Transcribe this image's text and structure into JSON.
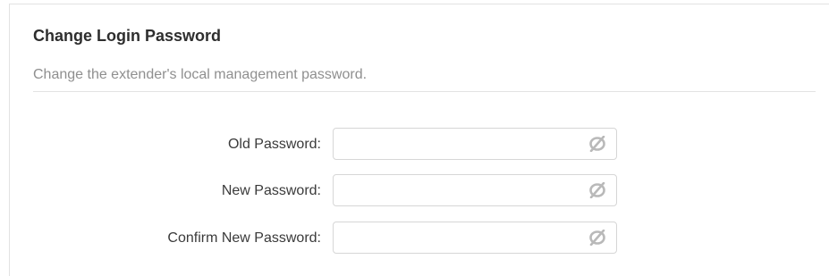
{
  "section": {
    "title": "Change Login Password",
    "description": "Change the extender's local management password."
  },
  "fields": [
    {
      "label": "Old Password:",
      "value": "",
      "icon": "hidden-eye-icon"
    },
    {
      "label": "New Password:",
      "value": "",
      "icon": "hidden-eye-icon"
    },
    {
      "label": "Confirm New Password:",
      "value": "",
      "icon": "hidden-eye-icon"
    }
  ],
  "colors": {
    "icon": "#b9b9b9",
    "border": "#d6d6d6",
    "muted_text": "#8f8f8f"
  }
}
